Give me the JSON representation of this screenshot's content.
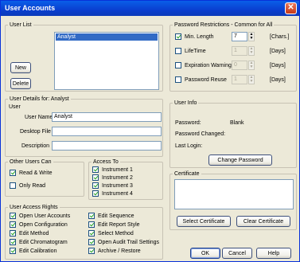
{
  "window": {
    "title": "User Accounts",
    "close_glyph": "✕"
  },
  "user_list": {
    "legend": "User List",
    "items": [
      "Analyst"
    ],
    "new_label": "New",
    "delete_label": "Delete"
  },
  "password_restrictions": {
    "legend": "Password Restrictions - Common for All",
    "rows": [
      {
        "label": "Min. Length",
        "checked": true,
        "value": "7",
        "unit": "[Chars.]",
        "enabled": true
      },
      {
        "label": "LifeTime",
        "checked": false,
        "value": "1",
        "unit": "[Days]",
        "enabled": false
      },
      {
        "label": "Expiration Warning",
        "checked": false,
        "value": "0",
        "unit": "[Days]",
        "enabled": false
      },
      {
        "label": "Password Reuse",
        "checked": false,
        "value": "1",
        "unit": "[Days]",
        "enabled": false
      }
    ]
  },
  "user_details": {
    "legend": "User Details for: Analyst",
    "user_legend": "User",
    "user_name_label": "User Name",
    "user_name_value": "Analyst",
    "desktop_file_label": "Desktop File",
    "desktop_file_value": "",
    "description_label": "Description",
    "description_value": ""
  },
  "user_info": {
    "legend": "User Info",
    "password_label": "Password:",
    "password_value": "Blank",
    "password_changed_label": "Password Changed:",
    "last_login_label": "Last Login:",
    "change_password_label": "Change Password"
  },
  "other_users": {
    "legend": "Other Users Can",
    "options": [
      {
        "label": "Read & Write",
        "checked": true
      },
      {
        "label": "Only Read",
        "checked": false
      }
    ]
  },
  "access_to": {
    "legend": "Access To",
    "items": [
      {
        "label": "Instrument 1",
        "checked": true
      },
      {
        "label": "Instrument 2",
        "checked": true
      },
      {
        "label": "Instrument 3",
        "checked": true
      },
      {
        "label": "Instrument 4",
        "checked": true
      }
    ]
  },
  "certificate": {
    "legend": "Certificate",
    "select_label": "Select Certificate",
    "clear_label": "Clear Certificate"
  },
  "access_rights": {
    "legend": "User Access Rights",
    "left": [
      {
        "label": "Open User Accounts",
        "checked": true
      },
      {
        "label": "Open Configuration",
        "checked": true
      },
      {
        "label": "Edit Method",
        "checked": true
      },
      {
        "label": "Edit Chromatogram",
        "checked": true
      },
      {
        "label": "Edit Calibration",
        "checked": true
      }
    ],
    "right": [
      {
        "label": "Edit Sequence",
        "checked": true
      },
      {
        "label": "Edit Report Style",
        "checked": true
      },
      {
        "label": "Select Method",
        "checked": true
      },
      {
        "label": "Open Audit Trail Settings",
        "checked": true
      },
      {
        "label": "Archive / Restore",
        "checked": true
      }
    ]
  },
  "footer": {
    "ok_label": "OK",
    "cancel_label": "Cancel",
    "help_label": "Help"
  }
}
